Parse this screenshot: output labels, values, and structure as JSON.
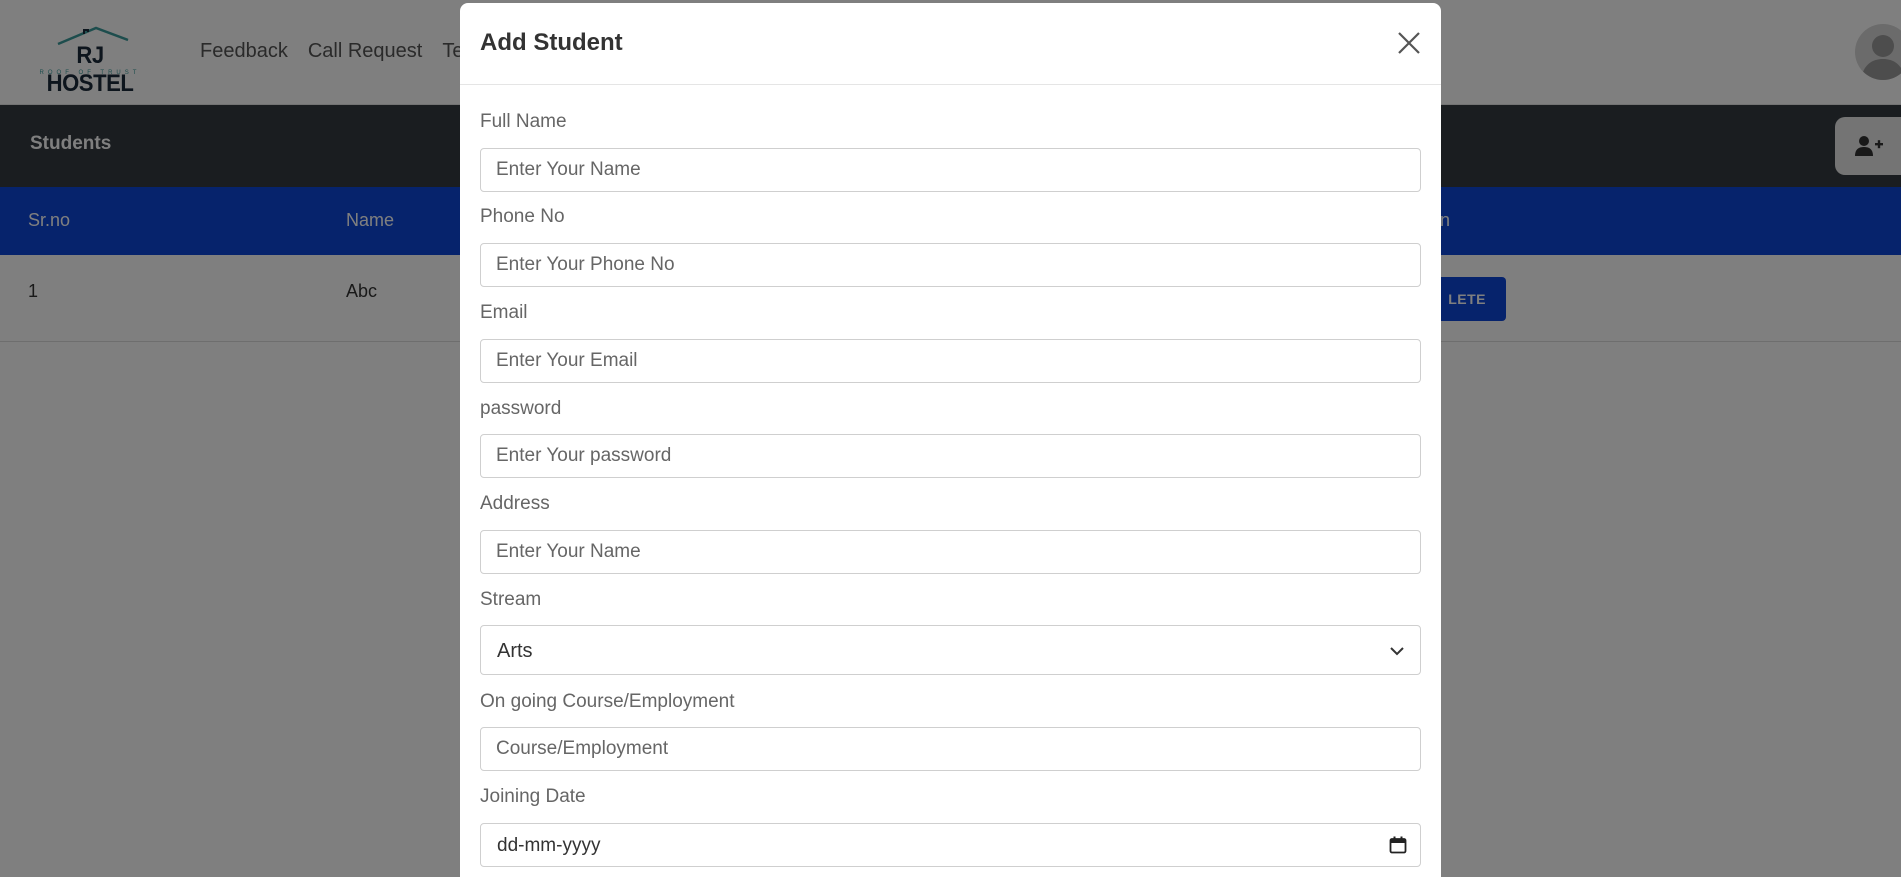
{
  "navbar": {
    "logo": {
      "name": "RJ HOSTEL",
      "tagline": "ROOF OF TRUST"
    },
    "links": [
      "Feedback",
      "Call Request",
      "Te"
    ]
  },
  "students_bar": {
    "title": "Students"
  },
  "table": {
    "headers": [
      "Sr.no",
      "Name",
      "n"
    ],
    "rows": [
      {
        "srno": "1",
        "name": "Abc",
        "action": "LETE"
      }
    ]
  },
  "modal": {
    "title": "Add Student",
    "fields": {
      "full_name": {
        "label": "Full Name",
        "placeholder": "Enter Your Name"
      },
      "phone": {
        "label": "Phone No",
        "placeholder": "Enter Your Phone No"
      },
      "email": {
        "label": "Email",
        "placeholder": "Enter Your Email"
      },
      "password": {
        "label": "password",
        "placeholder": "Enter Your password"
      },
      "address": {
        "label": "Address",
        "placeholder": "Enter Your Name"
      },
      "stream": {
        "label": "Stream",
        "value": "Arts"
      },
      "course": {
        "label": "On going Course/Employment",
        "placeholder": "Course/Employment"
      },
      "joining_date": {
        "label": "Joining Date",
        "value": "dd-mm-yyyy"
      }
    }
  },
  "colors": {
    "accent_blue": "#0d47d9",
    "dark_bar": "#343a40",
    "logo_teal": "#3a9a9a"
  }
}
